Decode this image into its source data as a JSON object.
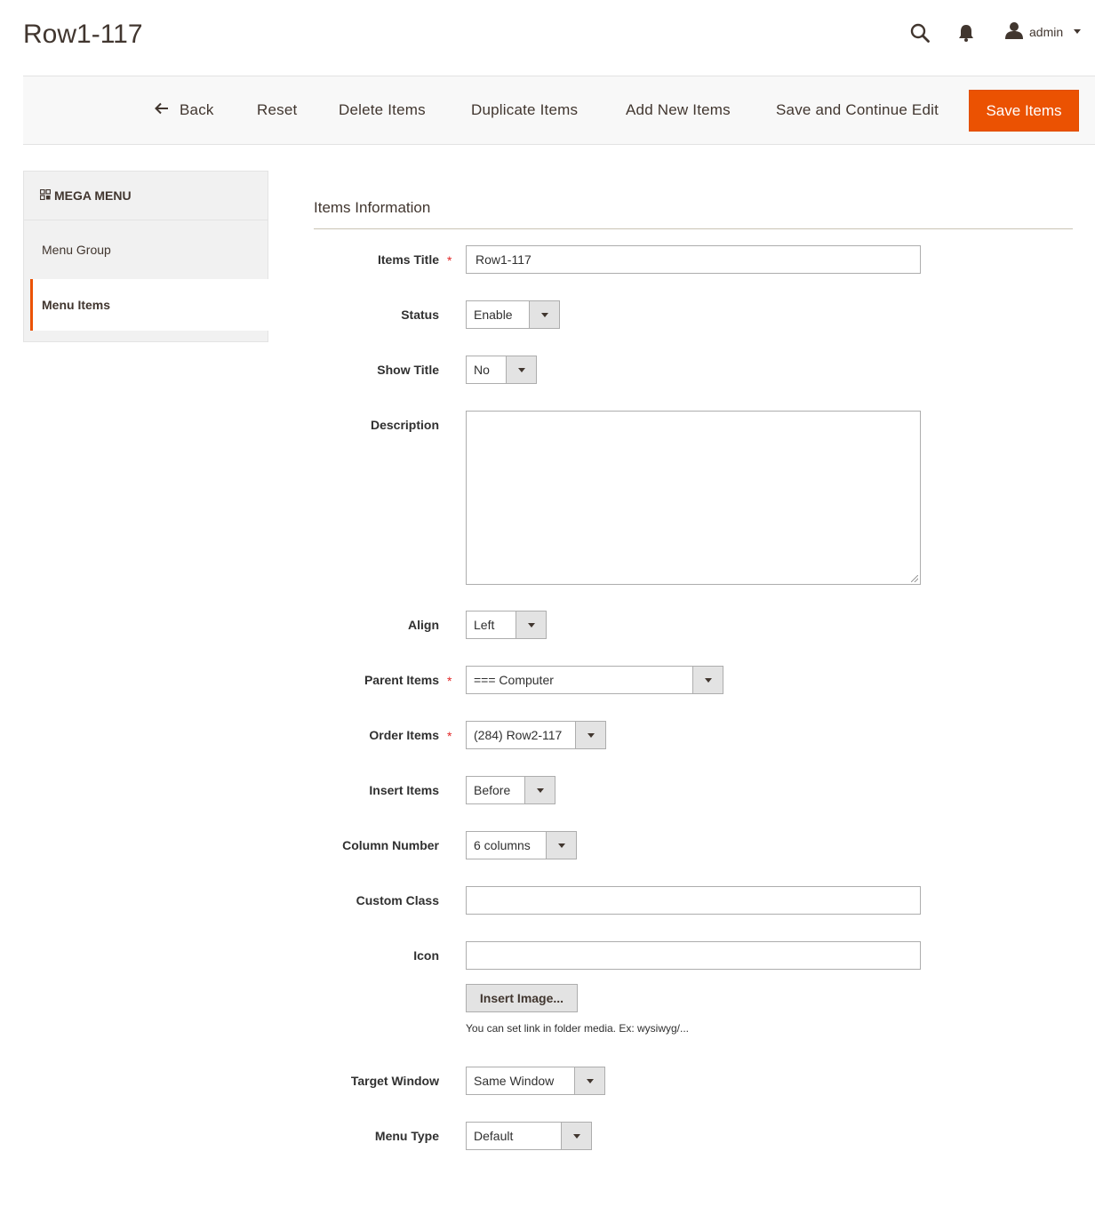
{
  "header": {
    "page_title": "Row1-117",
    "user_name": "admin"
  },
  "toolbar": {
    "back": "Back",
    "reset": "Reset",
    "delete": "Delete Items",
    "duplicate": "Duplicate Items",
    "add_new": "Add New Items",
    "save_continue": "Save and Continue Edit",
    "save": "Save Items"
  },
  "sidebar": {
    "title": "MEGA MENU",
    "items": [
      {
        "label": "Menu Group",
        "active": false
      },
      {
        "label": "Menu Items",
        "active": true
      }
    ]
  },
  "form": {
    "section_title": "Items Information",
    "items_title": {
      "label": "Items Title",
      "value": "Row1-117",
      "required": true
    },
    "status": {
      "label": "Status",
      "value": "Enable"
    },
    "show_title": {
      "label": "Show Title",
      "value": "No"
    },
    "description": {
      "label": "Description",
      "value": ""
    },
    "align": {
      "label": "Align",
      "value": "Left"
    },
    "parent_items": {
      "label": "Parent Items",
      "value": "=== Computer",
      "required": true
    },
    "order_items": {
      "label": "Order Items",
      "value": "(284) Row2-117",
      "required": true
    },
    "insert_items": {
      "label": "Insert Items",
      "value": "Before"
    },
    "column_number": {
      "label": "Column Number",
      "value": "6 columns"
    },
    "custom_class": {
      "label": "Custom Class",
      "value": ""
    },
    "icon": {
      "label": "Icon",
      "value": "",
      "insert_button": "Insert Image...",
      "hint": "You can set link in folder media. Ex: wysiwyg/..."
    },
    "target_window": {
      "label": "Target Window",
      "value": "Same Window"
    },
    "menu_type": {
      "label": "Menu Type",
      "value": "Default"
    },
    "required_mark": "*"
  },
  "colors": {
    "accent": "#eb5202",
    "required": "#e22626"
  }
}
